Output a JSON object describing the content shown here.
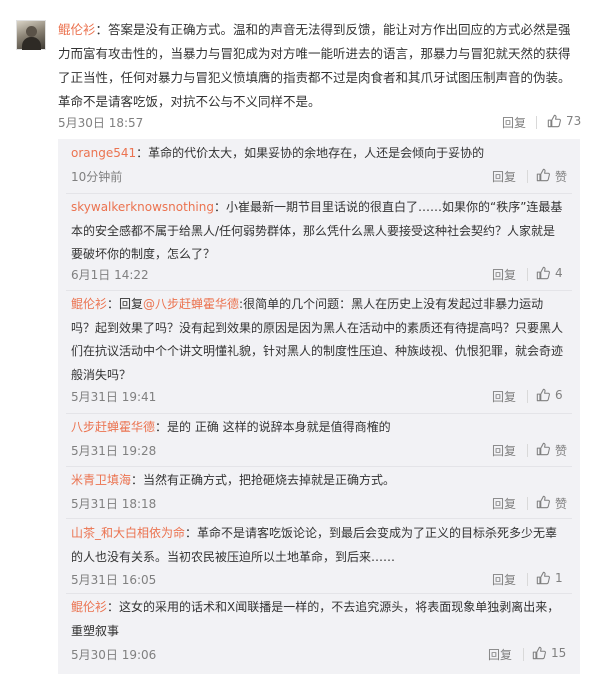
{
  "main_comment": {
    "user": "鲲伦衫",
    "text": "：答案是没有正确方式。温和的声音无法得到反馈，能让对方作出回应的方式必然是强力而富有攻击性的，当暴力与冒犯成为对方唯一能听进去的语言，那暴力与冒犯就天然的获得了正当性，任何对暴力与冒犯义愤填膺的指责都不过是肉食者和其爪牙试图压制声音的伪装。革命不是请客吃饭，对抗不公与不义同样不是。",
    "time": "5月30日 18:57",
    "reply_label": "回复",
    "likes": "73"
  },
  "replies": [
    {
      "user": "orange541",
      "text": "：革命的代价太大，如果妥协的余地存在，人还是会倾向于妥协的",
      "time": "10分钟前",
      "reply_label": "回复",
      "likes": "赞"
    },
    {
      "user": "skywalkerknowsnothing",
      "text": "：小崔最新一期节目里话说的很直白了……如果你的“秩序”连最基本的安全感都不属于给黑人/任何弱势群体，那么凭什么黑人要接受这种社会契约？人家就是要破坏你的制度，怎么了？",
      "time": "6月1日 14:22",
      "reply_label": "回复",
      "likes": "4"
    },
    {
      "user": "鲲伦衫",
      "pre": "：回复",
      "mention": "@八步赶蝉霍华德",
      "text": ":很简单的几个问题：黑人在历史上没有发起过非暴力运动吗？起到效果了吗？没有起到效果的原因是因为黑人在活动中的素质还有待提高吗？只要黑人们在抗议活动中个个讲文明懂礼貌，针对黑人的制度性压迫、种族歧视、仇恨犯罪，就会奇迹般消失吗？",
      "time": "5月31日 19:41",
      "reply_label": "回复",
      "likes": "6"
    },
    {
      "user": "八步赶蝉霍华德",
      "text": "：是的 正确 这样的说辞本身就是值得商榷的",
      "time": "5月31日 19:28",
      "reply_label": "回复",
      "likes": "赞"
    },
    {
      "user": "米青卫填海",
      "text": "：当然有正确方式，把抢砸烧去掉就是正确方式。",
      "time": "5月31日 18:18",
      "reply_label": "回复",
      "likes": "赞"
    },
    {
      "user": "山茶_和大白相依为命",
      "text": "：革命不是请客吃饭论论，到最后会变成为了正义的目标杀死多少无辜的人也没有关系。当初农民被压迫所以土地革命，到后来……",
      "time": "5月31日 16:05",
      "reply_label": "回复",
      "likes": "1"
    },
    {
      "user": "鲲伦衫",
      "text": "：这女的采用的话术和X闻联播是一样的，不去追究源头，将表面现象单独剥离出来，重塑叙事",
      "time": "5月30日 19:06",
      "reply_label": "回复",
      "likes": "15"
    }
  ],
  "colors": {
    "username": "#eb7350",
    "text": "#333333",
    "meta": "#808080",
    "reply_bg": "#f2f2f5"
  },
  "icons": {
    "like": "thumbs-up-icon"
  }
}
